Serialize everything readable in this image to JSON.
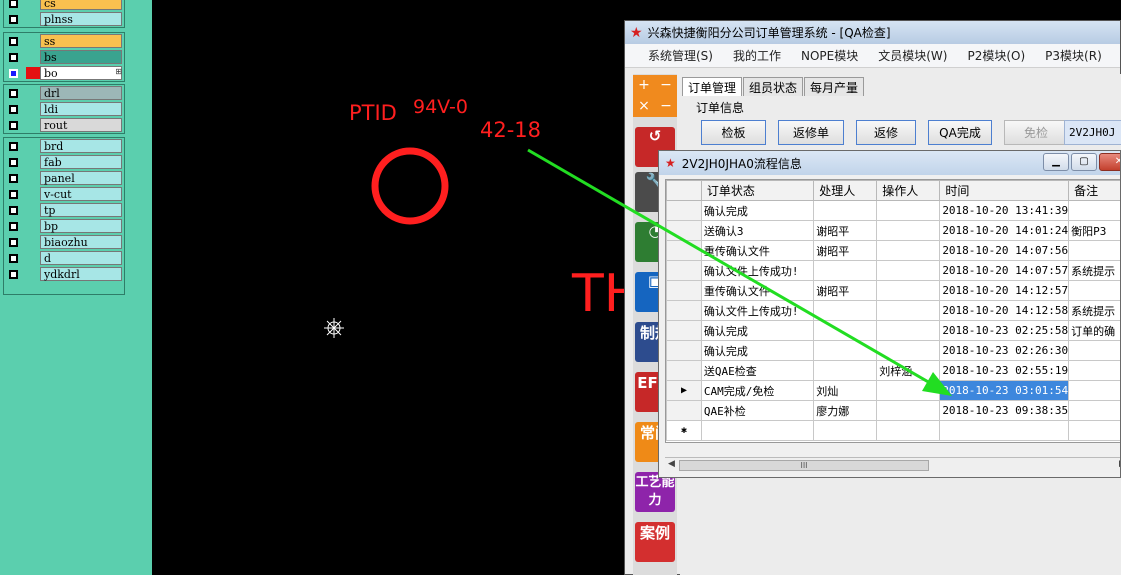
{
  "layers": {
    "group1": [
      {
        "name": "cs",
        "color": "#f9c04f"
      },
      {
        "name": "plnss",
        "color": "#a7e6e6"
      }
    ],
    "group2": [
      {
        "name": "ss",
        "color": "#f9c04f"
      },
      {
        "name": "bs",
        "color": "#3aa38f"
      },
      {
        "name": "bo",
        "color": "#ffffff",
        "active": true
      }
    ],
    "group3": [
      {
        "name": "drl",
        "color": "#9cb7b7"
      },
      {
        "name": "ldi",
        "color": "#a7e6e6"
      },
      {
        "name": "rout",
        "color": "#d9d9d9"
      }
    ],
    "group4": [
      {
        "name": "brd",
        "color": "#a7e6e6"
      },
      {
        "name": "fab",
        "color": "#a7e6e6"
      },
      {
        "name": "panel",
        "color": "#a7e6e6"
      },
      {
        "name": "v-cut",
        "color": "#a7e6e6"
      },
      {
        "name": "tp",
        "color": "#a7e6e6"
      },
      {
        "name": "bp",
        "color": "#a7e6e6"
      },
      {
        "name": "biaozhu",
        "color": "#a7e6e6"
      },
      {
        "name": "d",
        "color": "#a7e6e6"
      },
      {
        "name": "ydkdrl",
        "color": "#a7e6e6"
      }
    ]
  },
  "cam": {
    "label_ptid": "PTID",
    "label_94v": "94V-0",
    "label_date": "42-18",
    "label_th": "TH"
  },
  "main_window": {
    "title": "兴森快捷衡阳分公司订单管理系统 - [QA检查]",
    "menu": [
      "系统管理(S)",
      "我的工作",
      "NOPE模块",
      "文员模块(W)",
      "P2模块(O)",
      "P3模块(R)"
    ],
    "tabs": [
      "订单管理",
      "组员状态",
      "每月产量"
    ],
    "group_label": "订单信息",
    "buttons": [
      "检板",
      "返修单",
      "返修",
      "QA完成",
      "免检"
    ],
    "order_no": "2V2JH0J",
    "side_tools": [
      "制规",
      "EF规",
      "常问",
      "工艺能力",
      "案例"
    ]
  },
  "dialog": {
    "title": "2V2JH0JHA0流程信息",
    "columns": [
      "订单状态",
      "处理人",
      "操作人",
      "时间",
      "备注"
    ],
    "rows": [
      {
        "status": "确认完成",
        "handler": "",
        "operator": "",
        "time": "2018-10-20 13:41:39",
        "note": ""
      },
      {
        "status": "送确认3",
        "handler": "谢昭平",
        "operator": "",
        "time": "2018-10-20 14:01:24",
        "note": "衡阳P3"
      },
      {
        "status": "重传确认文件",
        "handler": "谢昭平",
        "operator": "",
        "time": "2018-10-20 14:07:56",
        "note": ""
      },
      {
        "status": "确认文件上传成功!",
        "handler": "",
        "operator": "",
        "time": "2018-10-20 14:07:57",
        "note": "系统提示"
      },
      {
        "status": "重传确认文件",
        "handler": "谢昭平",
        "operator": "",
        "time": "2018-10-20 14:12:57",
        "note": ""
      },
      {
        "status": "确认文件上传成功!",
        "handler": "",
        "operator": "",
        "time": "2018-10-20 14:12:58",
        "note": "系统提示"
      },
      {
        "status": "确认完成",
        "handler": "",
        "operator": "",
        "time": "2018-10-23 02:25:58",
        "note": "订单的确"
      },
      {
        "status": "确认完成",
        "handler": "",
        "operator": "",
        "time": "2018-10-23 02:26:30",
        "note": ""
      },
      {
        "status": "送QAE检查",
        "handler": "",
        "operator": "刘梓涵",
        "time": "2018-10-23 02:55:19",
        "note": ""
      },
      {
        "status": "CAM完成/免检",
        "handler": "刘灿",
        "operator": "",
        "time": "2018-10-23 03:01:54",
        "note": "",
        "selected": true
      },
      {
        "status": "QAE补检",
        "handler": "廖力娜",
        "operator": "",
        "time": "2018-10-23 09:38:35",
        "note": ""
      }
    ],
    "scroll_grip": "III"
  },
  "colors": {
    "arrow": "#22dd22",
    "cam_red": "#ff1f1f",
    "selection": "#3d87dd"
  }
}
